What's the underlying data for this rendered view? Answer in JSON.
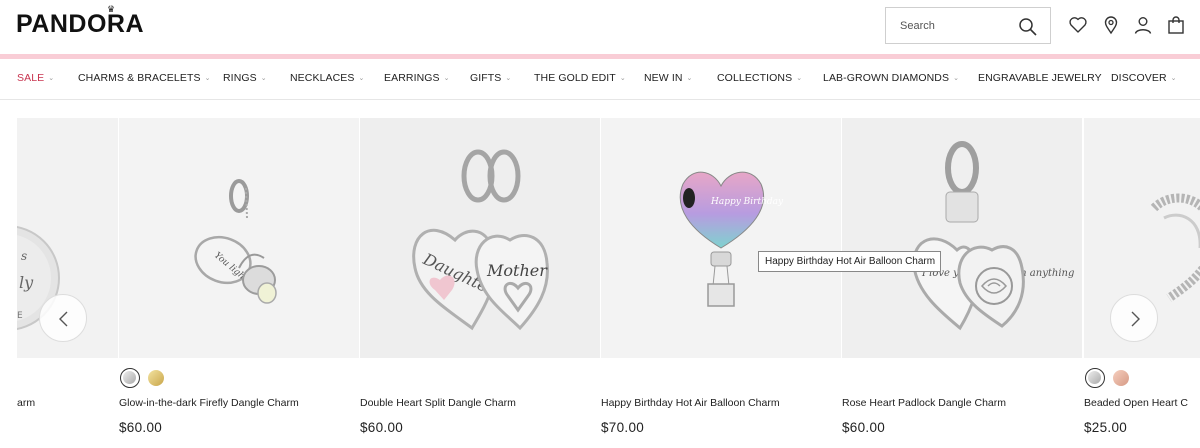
{
  "brand": "PANDORA",
  "colors": {
    "accent_pink": "#f9cdd6",
    "sale_red": "#c8344f",
    "image_bg": "#f2f2f2"
  },
  "search": {
    "placeholder": "Search"
  },
  "header_icons": [
    "heart-icon",
    "location-pin-icon",
    "user-icon",
    "shopping-bag-icon"
  ],
  "nav": {
    "items": [
      {
        "label": "SALE"
      },
      {
        "label": "CHARMS & BRACELETS"
      },
      {
        "label": "RINGS"
      },
      {
        "label": "NECKLACES"
      },
      {
        "label": "EARRINGS"
      },
      {
        "label": "GIFTS"
      },
      {
        "label": "THE GOLD EDIT"
      },
      {
        "label": "NEW IN"
      },
      {
        "label": "COLLECTIONS"
      },
      {
        "label": "LAB-GROWN DIAMONDS"
      },
      {
        "label": "ENGRAVABLE JEWELRY"
      },
      {
        "label": "DISCOVER"
      }
    ]
  },
  "products": [
    {
      "name": "arm",
      "price": ""
    },
    {
      "name": "Glow-in-the-dark Firefly Dangle Charm",
      "price": "$60.00",
      "swatches": [
        "silver",
        "gold"
      ]
    },
    {
      "name": "Double Heart Split Dangle Charm",
      "price": "$60.00"
    },
    {
      "name": "Happy Birthday Hot Air Balloon Charm",
      "price": "$70.00"
    },
    {
      "name": "Rose Heart Padlock Dangle Charm",
      "price": "$60.00"
    },
    {
      "name": "Beaded Open Heart C",
      "price": "$25.00",
      "swatches": [
        "silver",
        "rose-gold"
      ]
    }
  ],
  "tooltip": "Happy Birthday Hot Air Balloon Charm",
  "charm_engravings": {
    "firefly": "You light my",
    "daughter": "Daughter",
    "mother": "Mother",
    "balloon": "Happy Birthday",
    "padlock": "I love you more than anything"
  }
}
